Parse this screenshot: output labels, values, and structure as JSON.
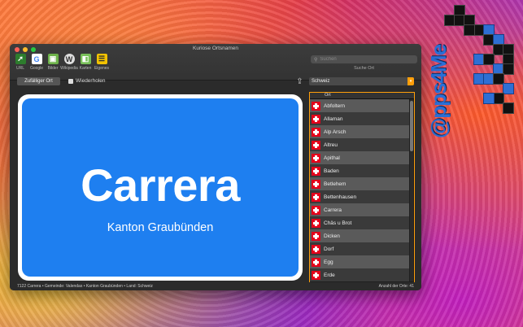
{
  "window": {
    "title": "Kuriose Ortsnamen"
  },
  "toolbar": {
    "items": [
      {
        "label": "URL",
        "icon": "url-cursor-icon"
      },
      {
        "label": "Google",
        "icon": "google-icon"
      },
      {
        "label": "Bilder",
        "icon": "images-icon"
      },
      {
        "label": "Wikipedia",
        "icon": "wikipedia-icon"
      },
      {
        "label": "Karten",
        "icon": "map-icon"
      },
      {
        "label": "Eigenes",
        "icon": "custom-icon"
      }
    ]
  },
  "search": {
    "placeholder": "Suchen",
    "label": "Suche Ort"
  },
  "controls": {
    "random_button": "Zufälliger Ort",
    "repeat_label": "Wiederholen",
    "country": "Schweiz"
  },
  "sign": {
    "name": "Carrera",
    "region": "Kanton Graubünden"
  },
  "list": {
    "header": "Ort",
    "items": [
      "Abfoltern",
      "Allaman",
      "Alp Arsch",
      "Altreu",
      "Apithal",
      "Baden",
      "Betlehem",
      "Bettenhausen",
      "Carrera",
      "Chäs u Brot",
      "Dicken",
      "Dorf",
      "Egg",
      "Erde"
    ]
  },
  "status": {
    "left": "7122 Carrera • Gemeinde: Valendas • Kanton Graubünden • Land: Schweiz",
    "right": "Anzahl der Orte: 41"
  },
  "watermark": {
    "text": "@pps4Me"
  },
  "colors": {
    "sign_blue": "#1e7ff0",
    "accent_orange": "#ff9f0a",
    "swiss_red": "#e3001b"
  }
}
